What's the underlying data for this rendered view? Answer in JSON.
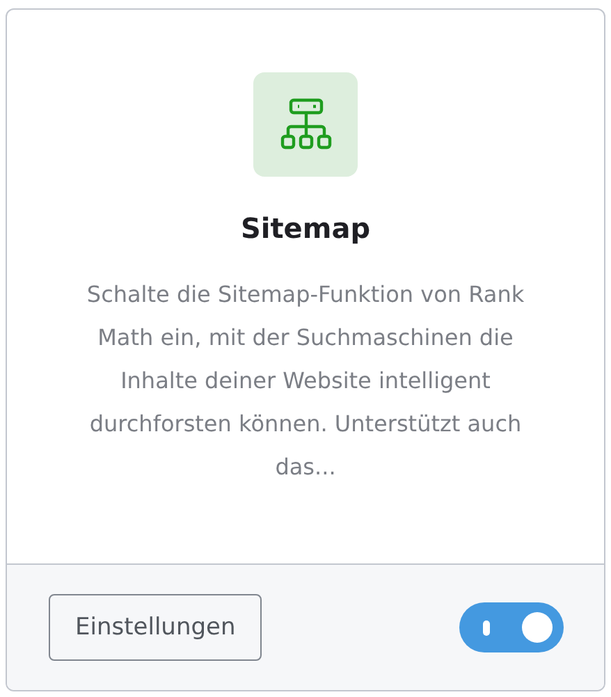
{
  "card": {
    "title": "Sitemap",
    "description": "Schalte die Sitemap-Funktion von Rank Math ein, mit der Suchmaschinen die Inhalte deiner Website intelligent durchforsten können. Unterstützt auch das...",
    "settings_button": "Einstellungen",
    "toggle": {
      "on": true
    }
  }
}
